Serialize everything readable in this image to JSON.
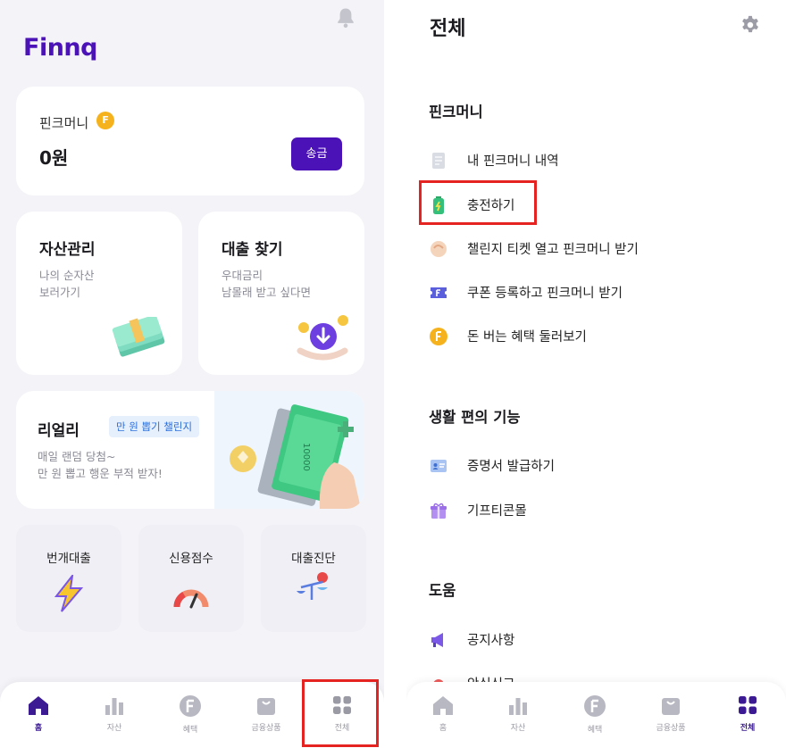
{
  "home": {
    "logo": "Finnq",
    "finnq_money": {
      "label": "핀크머니",
      "coin": "F",
      "amount": "0원",
      "send_label": "송금"
    },
    "cards": {
      "asset": {
        "title": "자산관리",
        "sub1": "나의 순자산",
        "sub2": "보러가기"
      },
      "loan": {
        "title": "대출 찾기",
        "sub1": "우대금리",
        "sub2": "남몰래 받고 싶다면"
      }
    },
    "realy": {
      "title": "리얼리",
      "badge": "만 원 뽑기 챌린지",
      "sub1": "매일 랜덤 당첨~",
      "sub2": "만 원 뽑고 행운 부적 받자!",
      "note": "10000"
    },
    "quick": [
      {
        "label": "번개대출"
      },
      {
        "label": "신용점수"
      },
      {
        "label": "대출진단"
      }
    ],
    "nav": [
      {
        "label": "홈",
        "active": true
      },
      {
        "label": "자산",
        "active": false
      },
      {
        "label": "혜택",
        "active": false
      },
      {
        "label": "금융상품",
        "active": false
      },
      {
        "label": "전체",
        "active": false
      }
    ]
  },
  "all": {
    "title": "전체",
    "sections": [
      {
        "title": "핀크머니",
        "items": [
          {
            "label": "내 핀크머니 내역",
            "icon": "receipt-icon"
          },
          {
            "label": "충전하기",
            "icon": "battery-icon"
          },
          {
            "label": "챌린지 티켓 열고 핀크머니 받기",
            "icon": "hand-icon"
          },
          {
            "label": "쿠폰 등록하고 핀크머니 받기",
            "icon": "coupon-icon"
          },
          {
            "label": "돈 버는 혜택 둘러보기",
            "icon": "f-coin-icon"
          }
        ]
      },
      {
        "title": "생활 편의 기능",
        "items": [
          {
            "label": "증명서 발급하기",
            "icon": "id-card-icon"
          },
          {
            "label": "기프티콘몰",
            "icon": "gift-icon"
          }
        ]
      },
      {
        "title": "도움",
        "items": [
          {
            "label": "공지사항",
            "icon": "megaphone-icon"
          },
          {
            "label": "안심신고",
            "icon": "siren-icon"
          }
        ]
      }
    ],
    "nav": [
      {
        "label": "홈",
        "active": false
      },
      {
        "label": "자산",
        "active": false
      },
      {
        "label": "혜택",
        "active": false
      },
      {
        "label": "금융상품",
        "active": false
      },
      {
        "label": "전체",
        "active": true
      }
    ]
  },
  "colors": {
    "brand": "#4b12b8",
    "highlight": "#e52421",
    "coin": "#f6b21c"
  }
}
